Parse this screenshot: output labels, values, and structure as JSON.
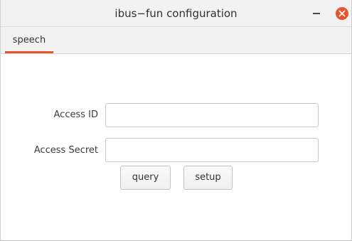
{
  "window": {
    "title": "ibus−fun configuration"
  },
  "tabs": [
    {
      "label": "speech",
      "active": true
    }
  ],
  "form": {
    "access_id": {
      "label": "Access ID",
      "value": "",
      "placeholder": ""
    },
    "access_secret": {
      "label": "Access Secret",
      "value": "",
      "placeholder": ""
    }
  },
  "buttons": {
    "query": "query",
    "setup": "setup"
  },
  "colors": {
    "accent": "#e9552b",
    "titlebar_bg": "#f2f2f2",
    "content_bg": "#ffffff"
  },
  "icons": {
    "minimize": "minimize-icon",
    "close": "close-icon"
  }
}
